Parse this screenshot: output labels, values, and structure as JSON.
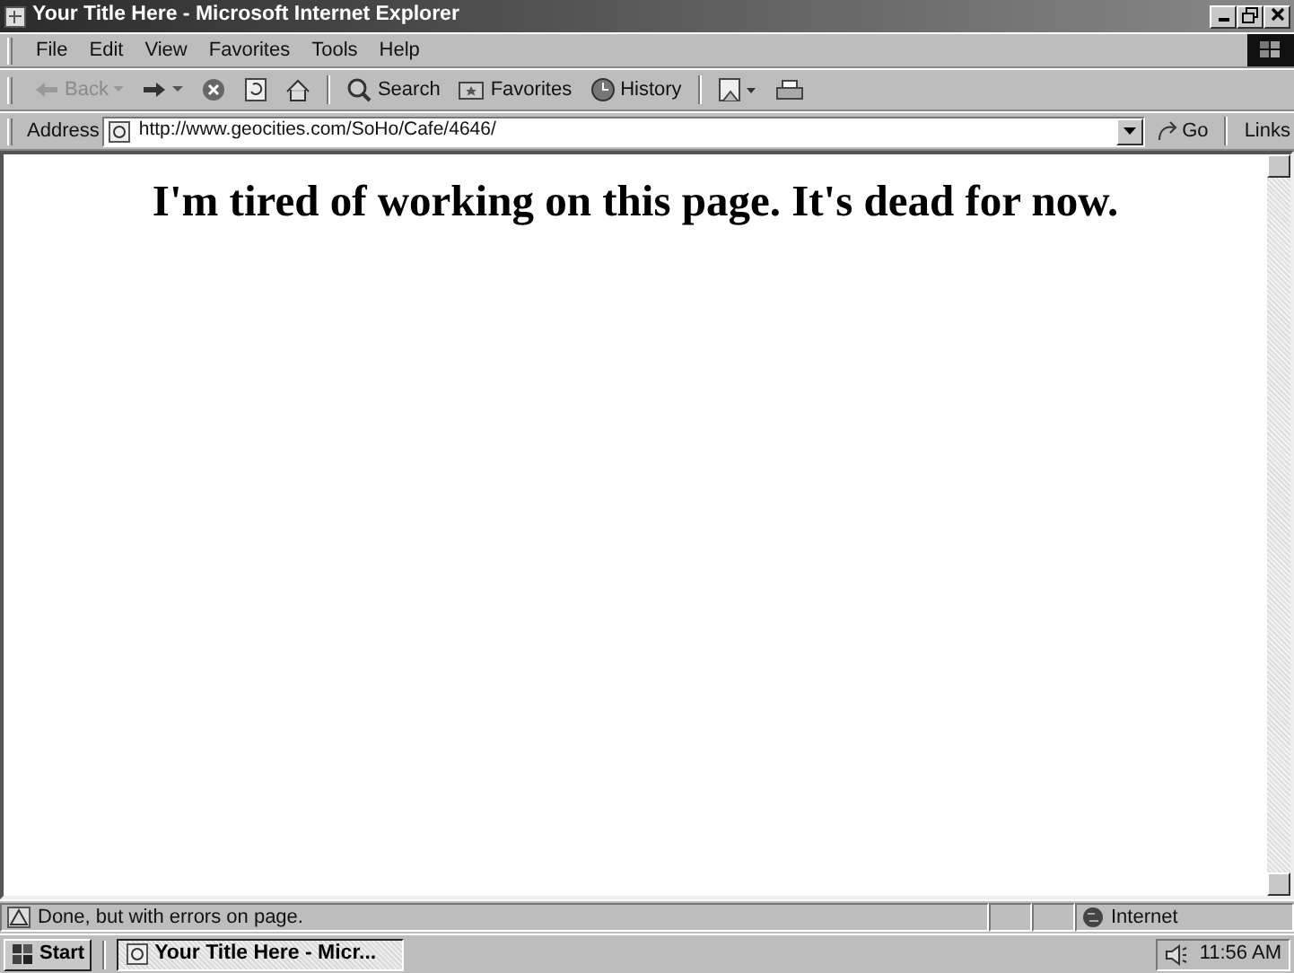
{
  "window": {
    "title": "Your Title Here - Microsoft Internet Explorer"
  },
  "menu": [
    {
      "label": "File"
    },
    {
      "label": "Edit"
    },
    {
      "label": "View"
    },
    {
      "label": "Favorites"
    },
    {
      "label": "Tools"
    },
    {
      "label": "Help"
    }
  ],
  "toolbar": [
    {
      "kind": "back",
      "label": "Back",
      "disabled": true
    },
    {
      "kind": "forward",
      "disabled": false
    },
    {
      "kind": "stop"
    },
    {
      "kind": "refresh"
    },
    {
      "kind": "home"
    },
    {
      "kind": "search",
      "label": "Search"
    },
    {
      "kind": "favorites",
      "label": "Favorites"
    },
    {
      "kind": "history",
      "label": "History"
    },
    {
      "kind": "mail"
    },
    {
      "kind": "print"
    }
  ],
  "address_bar": {
    "label": "Address",
    "value": "http://www.geocities.com/SoHo/Cafe/4646/",
    "go": "Go",
    "links": "Links"
  },
  "page": {
    "heading": "I'm tired of working on this page. It's dead for now."
  },
  "status_bar": {
    "message": "Done, but with errors on page.",
    "zone": "Internet"
  },
  "taskbar": {
    "start": "Start",
    "tasks": [
      {
        "label": "Your Title Here - Micr...",
        "selected": true
      }
    ],
    "clock": "11:56 AM"
  }
}
